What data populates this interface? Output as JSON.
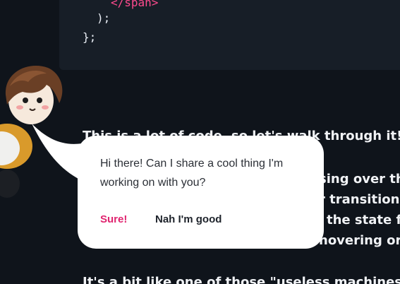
{
  "code": {
    "lines": [
      {
        "text": "</span>",
        "color": "pink"
      },
      {
        "text": ");",
        "color": "plain"
      },
      {
        "text": "};",
        "color": "plain"
      }
    ]
  },
  "article": {
    "line1": "This is a lot of code, so let's walk through it!",
    "frag_hover": "sing over thi",
    "frag_transition": "r transition. I",
    "frag_state": "the state flip",
    "frag_hovering": "hovering or n",
    "line_bottom": "It's a bit like one of those \"useless machines\" that tu"
  },
  "bubble": {
    "message": "Hi there! Can I share a cool thing I'm working on with you?",
    "accept_label": "Sure!",
    "decline_label": "Nah I'm good"
  },
  "colors": {
    "background": "#0f141b",
    "code_bg": "#171e27",
    "accent_pink": "#e0246f",
    "bubble_bg": "#ffffff"
  }
}
